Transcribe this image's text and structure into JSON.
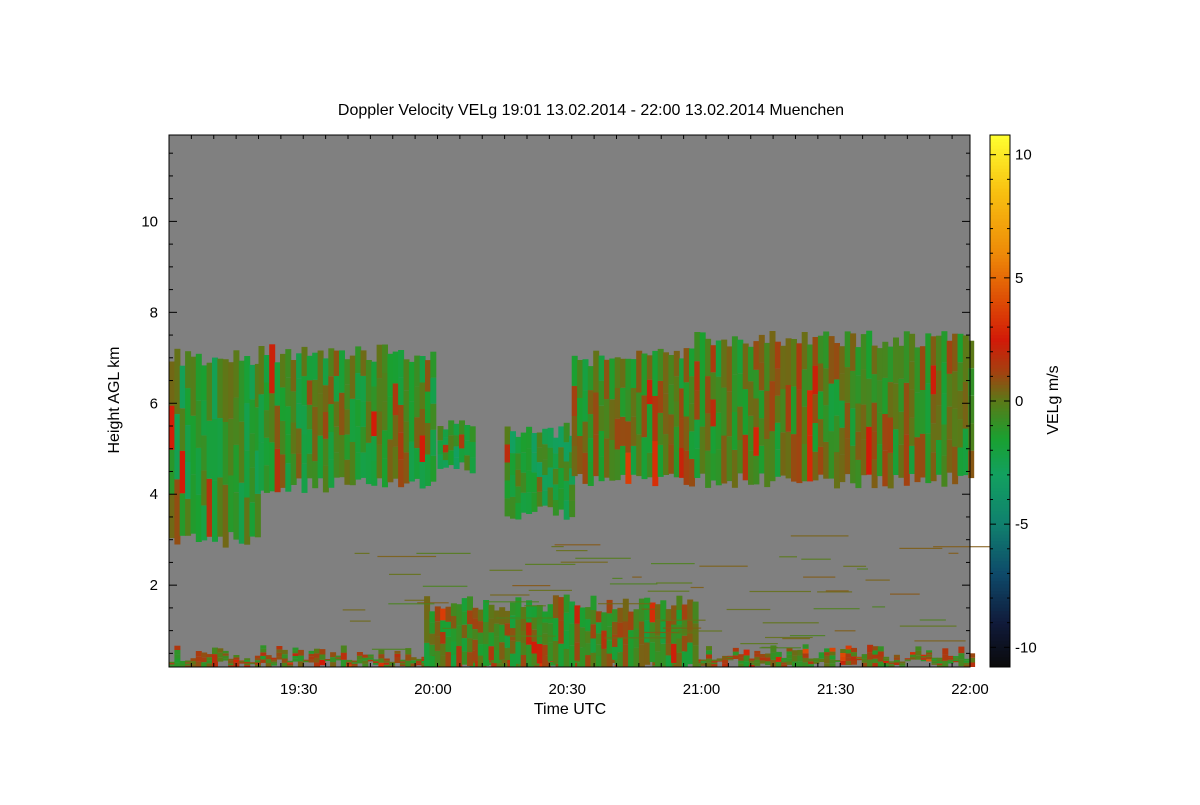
{
  "chart_data": {
    "type": "heatmap",
    "title": "Doppler Velocity VELg   19:01 13.02.2014 - 22:00 13.02.2014 Muenchen",
    "xlabel": "Time UTC",
    "ylabel": "Height AGL km",
    "colorbar_label": "VELg m/s",
    "x_tick_labels": [
      "19:30",
      "20:00",
      "20:30",
      "21:00",
      "21:30",
      "22:00"
    ],
    "x_tick_minutes": [
      29,
      59,
      89,
      119,
      149,
      179
    ],
    "xlim_minutes_after_19_01": [
      0,
      179
    ],
    "y_ticks": [
      2,
      4,
      6,
      8,
      10
    ],
    "y_tick_labels": [
      "2",
      "4",
      "6",
      "8",
      "10"
    ],
    "ylim": [
      0.2,
      11.9
    ],
    "colorbar_ticks": [
      10,
      5,
      0,
      -5,
      -10
    ],
    "colorbar_tick_labels": [
      "10",
      "5",
      "0",
      "-5",
      "-10"
    ],
    "colorbar_range": [
      -10.8,
      10.8
    ],
    "background_color": "#808080",
    "colormap": [
      {
        "v": -10.8,
        "c": "#0a0a0a"
      },
      {
        "v": -9,
        "c": "#101a3a"
      },
      {
        "v": -7,
        "c": "#0e4a6a"
      },
      {
        "v": -5,
        "c": "#10806e"
      },
      {
        "v": -3,
        "c": "#12a060"
      },
      {
        "v": -1.5,
        "c": "#1aa030"
      },
      {
        "v": 0,
        "c": "#5a7a18"
      },
      {
        "v": 1.2,
        "c": "#a44010"
      },
      {
        "v": 2.5,
        "c": "#d21a08"
      },
      {
        "v": 4,
        "c": "#dd4a05"
      },
      {
        "v": 6,
        "c": "#ee8a08"
      },
      {
        "v": 8.5,
        "c": "#f8c010"
      },
      {
        "v": 10.8,
        "c": "#ffff30"
      }
    ],
    "cloud_regions": [
      {
        "name": "early-deep-cloud",
        "t0": 0,
        "t1": 20,
        "base": 3.0,
        "top": 7.0,
        "mean_vel": -1.2
      },
      {
        "name": "early-descending-cloud",
        "t0": 20,
        "t1": 59,
        "base": 4.2,
        "top": 7.1,
        "mean_vel": -0.8
      },
      {
        "name": "small-patch-2010",
        "t0": 60,
        "t1": 68,
        "base": 4.6,
        "top": 5.5,
        "mean_vel": -1.5
      },
      {
        "name": "mid-cloud",
        "t0": 75,
        "t1": 90,
        "base": 3.6,
        "top": 5.4,
        "mean_vel": -1.6
      },
      {
        "name": "growing-cloud",
        "t0": 90,
        "t1": 115,
        "base": 4.3,
        "top": 7.0,
        "mean_vel": -0.5
      },
      {
        "name": "late-deep-cloud",
        "t0": 115,
        "t1": 179,
        "base": 4.3,
        "top": 7.4,
        "mean_vel": -0.4
      },
      {
        "name": "boundary-layer",
        "t0": 0,
        "t1": 179,
        "base": 0.2,
        "top": 0.5,
        "mean_vel": 0.2
      },
      {
        "name": "low-precip-layer",
        "t0": 57,
        "t1": 118,
        "base": 0.2,
        "top": 1.6,
        "mean_vel": -0.4
      }
    ]
  }
}
